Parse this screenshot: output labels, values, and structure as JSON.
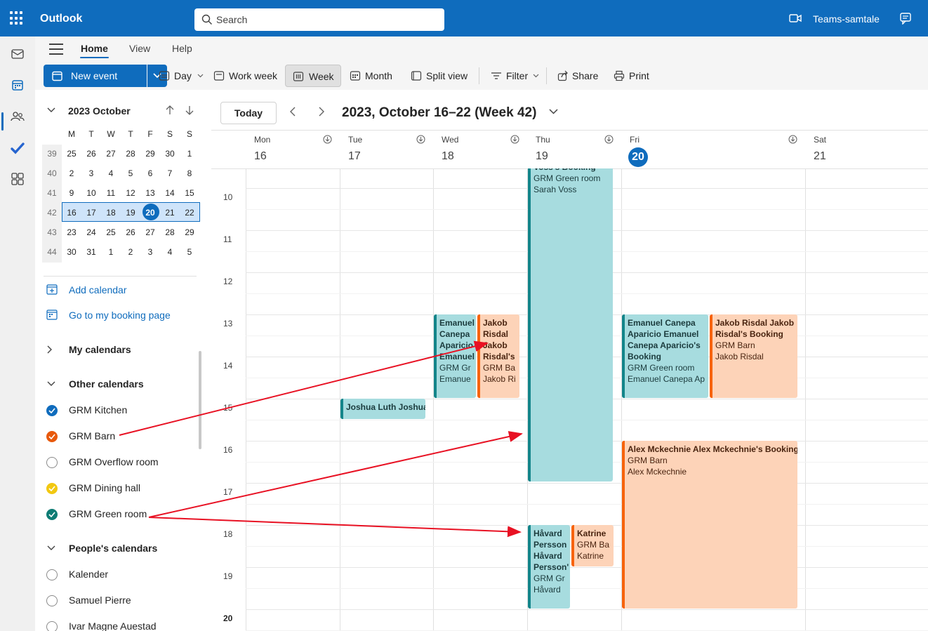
{
  "app": {
    "title": "Outlook",
    "search_placeholder": "Search",
    "teams_label": "Teams-samtale"
  },
  "ribbon": {
    "tabs": [
      "Home",
      "View",
      "Help"
    ],
    "new_event": "New event",
    "views": [
      "Day",
      "Work week",
      "Week",
      "Month",
      "Split view"
    ],
    "selected_view": "Week",
    "filter": "Filter",
    "share": "Share",
    "print": "Print"
  },
  "mini_calendar": {
    "title": "2023 October",
    "weekday_headers": [
      "M",
      "T",
      "W",
      "T",
      "F",
      "S",
      "S"
    ],
    "weeks": [
      {
        "wk": "39",
        "days": [
          "25",
          "26",
          "27",
          "28",
          "29",
          "30",
          "1"
        ]
      },
      {
        "wk": "40",
        "days": [
          "2",
          "3",
          "4",
          "5",
          "6",
          "7",
          "8"
        ]
      },
      {
        "wk": "41",
        "days": [
          "9",
          "10",
          "11",
          "12",
          "13",
          "14",
          "15"
        ]
      },
      {
        "wk": "42",
        "days": [
          "16",
          "17",
          "18",
          "19",
          "20",
          "21",
          "22"
        ]
      },
      {
        "wk": "43",
        "days": [
          "23",
          "24",
          "25",
          "26",
          "27",
          "28",
          "29"
        ]
      },
      {
        "wk": "44",
        "days": [
          "30",
          "31",
          "1",
          "2",
          "3",
          "4",
          "5"
        ]
      }
    ],
    "selected_week_index": 3,
    "today_day_index": 4
  },
  "left_pane": {
    "add_calendar": "Add calendar",
    "booking_page": "Go to my booking page",
    "my_calendars": "My calendars",
    "other_calendars": "Other calendars",
    "other_list": [
      {
        "name": "GRM Kitchen",
        "color": "#0f6cbd",
        "checked": true
      },
      {
        "name": "GRM Barn",
        "color": "#e8590c",
        "checked": true
      },
      {
        "name": "GRM Overflow room",
        "color": "#8a8a8a",
        "checked": false
      },
      {
        "name": "GRM Dining hall",
        "color": "#f2c811",
        "checked": true
      },
      {
        "name": "GRM Green room",
        "color": "#0e7c74",
        "checked": true
      }
    ],
    "peoples_calendars": "People's calendars",
    "people_list": [
      "Kalender",
      "Samuel Pierre",
      "Ivar Magne Auestad"
    ]
  },
  "calendar": {
    "today_label": "Today",
    "range_title": "2023, October 16–22 (Week 42)",
    "days": [
      {
        "name": "Mon",
        "num": "16"
      },
      {
        "name": "Tue",
        "num": "17"
      },
      {
        "name": "Wed",
        "num": "18"
      },
      {
        "name": "Thu",
        "num": "19"
      },
      {
        "name": "Fri",
        "num": "20",
        "today": true
      },
      {
        "name": "Sat",
        "num": "21"
      }
    ],
    "hours": [
      "10",
      "11",
      "12",
      "13",
      "14",
      "15",
      "16",
      "17",
      "18",
      "19",
      "20"
    ],
    "events": [
      {
        "id": "thu-sarah",
        "kind": "green",
        "lines": [
          "Voss's Booking",
          "GRM Green room",
          "Sarah Voss"
        ]
      },
      {
        "id": "wed-emanuel",
        "kind": "green",
        "lines": [
          "Emanuel",
          "Canepa",
          "Aparicio",
          "Emanuel",
          "GRM Gr",
          "Emanue"
        ]
      },
      {
        "id": "wed-jakob",
        "kind": "orange",
        "lines": [
          "Jakob",
          "Risdal",
          "Jakob",
          "Risdal's",
          "GRM Ba",
          "Jakob Ri"
        ]
      },
      {
        "id": "fri-emanuel",
        "kind": "green",
        "lines": [
          "Emanuel Canepa",
          "Aparicio Emanuel",
          "Canepa Aparicio's",
          "Booking",
          "GRM Green room",
          "Emanuel Canepa Ap"
        ]
      },
      {
        "id": "fri-jakob",
        "kind": "orange",
        "lines": [
          "Jakob Risdal Jakob",
          "Risdal's Booking",
          "GRM Barn",
          "Jakob Risdal"
        ]
      },
      {
        "id": "tue-joshua",
        "kind": "green",
        "lines": [
          "Joshua Luth Joshua"
        ]
      },
      {
        "id": "fri-alex",
        "kind": "orange",
        "lines": [
          "Alex Mckechnie Alex Mckechnie's Booking",
          "GRM Barn",
          "Alex Mckechnie"
        ]
      },
      {
        "id": "thu-havard",
        "kind": "green",
        "lines": [
          "Håvard",
          "Persson",
          "Håvard",
          "Persson'",
          "GRM Gr",
          "Håvard"
        ]
      },
      {
        "id": "thu-katrine",
        "kind": "orange",
        "lines": [
          "Katrine",
          "GRM Ba",
          "Katrine"
        ]
      }
    ]
  },
  "colors": {
    "brand": "#0f6cbd",
    "green_event": "#a7dcdf",
    "orange_event": "#fdd3b8",
    "annotation_arrow": "#e81123"
  }
}
